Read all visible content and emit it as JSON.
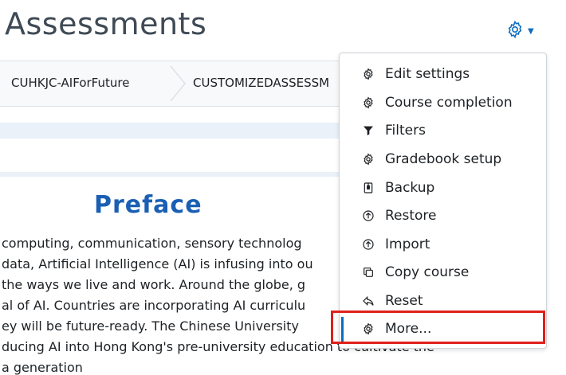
{
  "page": {
    "title": "Assessments"
  },
  "breadcrumb": {
    "items": [
      "CUHKJC-AIForFuture",
      "CUSTOMIZEDASSESSM"
    ]
  },
  "content": {
    "heading": "Preface",
    "lines": [
      "computing, communication, sensory technolog",
      "data, Artificial Intelligence (AI) is infusing into ou",
      "the ways we live and work.  Around the globe, g",
      "al of AI.  Countries are incorporating AI curriculu",
      "ey will be future-ready.  The Chinese University",
      "ducing AI into Hong Kong's pre-university education to cultivate the",
      "a generation"
    ]
  },
  "menu": {
    "items": [
      {
        "label": "Edit settings",
        "icon": "gear-icon"
      },
      {
        "label": "Course completion",
        "icon": "gear-icon"
      },
      {
        "label": "Filters",
        "icon": "filter-icon"
      },
      {
        "label": "Gradebook setup",
        "icon": "gear-icon"
      },
      {
        "label": "Backup",
        "icon": "backup-file-icon"
      },
      {
        "label": "Restore",
        "icon": "upload-circle-icon"
      },
      {
        "label": "Import",
        "icon": "upload-circle-icon"
      },
      {
        "label": "Copy course",
        "icon": "copy-icon"
      },
      {
        "label": "Reset",
        "icon": "reply-icon"
      },
      {
        "label": "More...",
        "icon": "gear-icon"
      }
    ],
    "selected": "More..."
  },
  "colors": {
    "accent": "#0f6cbf",
    "heading": "#1a5fb4",
    "highlight": "#e0201b"
  }
}
